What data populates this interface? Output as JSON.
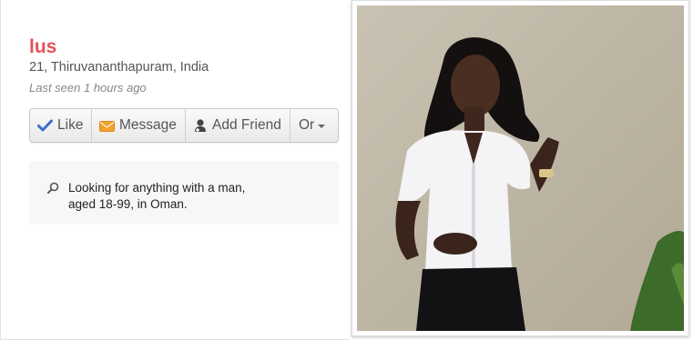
{
  "profile": {
    "name": "lus",
    "meta": "21, Thiruvananthapuram, India",
    "last_seen": "Last seen 1 hours ago"
  },
  "actions": {
    "like": "Like",
    "message": "Message",
    "add_friend": "Add Friend",
    "more": "Or"
  },
  "looking_for": {
    "line1": "Looking for anything with a man,",
    "line2": "aged 18-99, in Oman."
  },
  "photo": {
    "icon": "profile-photo"
  },
  "colors": {
    "name": "#e4515c",
    "like_check": "#3b6fd1",
    "message_icon": "#f0a22c"
  }
}
